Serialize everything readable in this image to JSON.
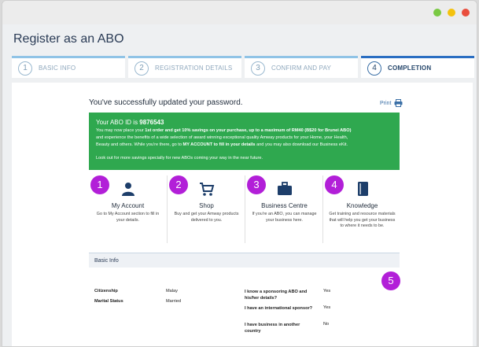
{
  "window": {
    "controls": [
      "green",
      "yellow",
      "red"
    ]
  },
  "page": {
    "title": "Register as an ABO"
  },
  "steps": [
    {
      "num": "1",
      "label": "BASIC INFO",
      "active": false
    },
    {
      "num": "2",
      "label": "REGISTRATION DETAILS",
      "active": false
    },
    {
      "num": "3",
      "label": "CONFIRM AND PAY",
      "active": false
    },
    {
      "num": "4",
      "label": "COMPLETION",
      "active": true
    }
  ],
  "success": {
    "message": "You've successfully updated your password.",
    "print_label": "Print"
  },
  "abo": {
    "id_label": "Your ABO ID is",
    "id_value": "9876543",
    "line1a": "You may now place your ",
    "line1b": "1st order and get 10% savings on your purchase, up to a maximum of RM40 (B$20 for Brunei ABO)",
    "line2": "and experience the benefits of a wide selection of award winning exceptional quality Amway products for your Home, your Health,",
    "line3a": "Beauty and others. While you're there, go to ",
    "line3b": "MY ACCOUNT to fill in your details",
    "line3c": " and you may also download our Business eKit.",
    "footer": "Look out for more savings specially for new ABOs coming your way in the near future."
  },
  "features": [
    {
      "num": "1",
      "icon": "user-icon",
      "title": "My Account",
      "desc": "Go to My Account section to fill in your details."
    },
    {
      "num": "2",
      "icon": "cart-icon",
      "title": "Shop",
      "desc": "Buy and get your Amway products delivered to you."
    },
    {
      "num": "3",
      "icon": "briefcase-icon",
      "title": "Business Centre",
      "desc": "If you're an ABO, you can manage your business here."
    },
    {
      "num": "4",
      "icon": "notebook-icon",
      "title": "Knowledge",
      "desc": "Get training and resource materials that will help you get your business to where it needs to be."
    }
  ],
  "basic_info": {
    "header": "Basic Info",
    "badge": "5",
    "left": [
      {
        "key": "Citizenship",
        "value": "Malay"
      },
      {
        "key": "Marital Status",
        "value": "Married"
      }
    ],
    "right": [
      {
        "key": "I know a sponsoring ABO and his/her details?",
        "value": "Yes"
      },
      {
        "key": "I have an international sponsor?",
        "value": "Yes"
      },
      {
        "key": "I have business in another country",
        "value": "No"
      }
    ]
  },
  "colors": {
    "accent_green": "#2fa84f",
    "badge_purple": "#b21fd8",
    "brand_blue": "#2a6ec2"
  }
}
